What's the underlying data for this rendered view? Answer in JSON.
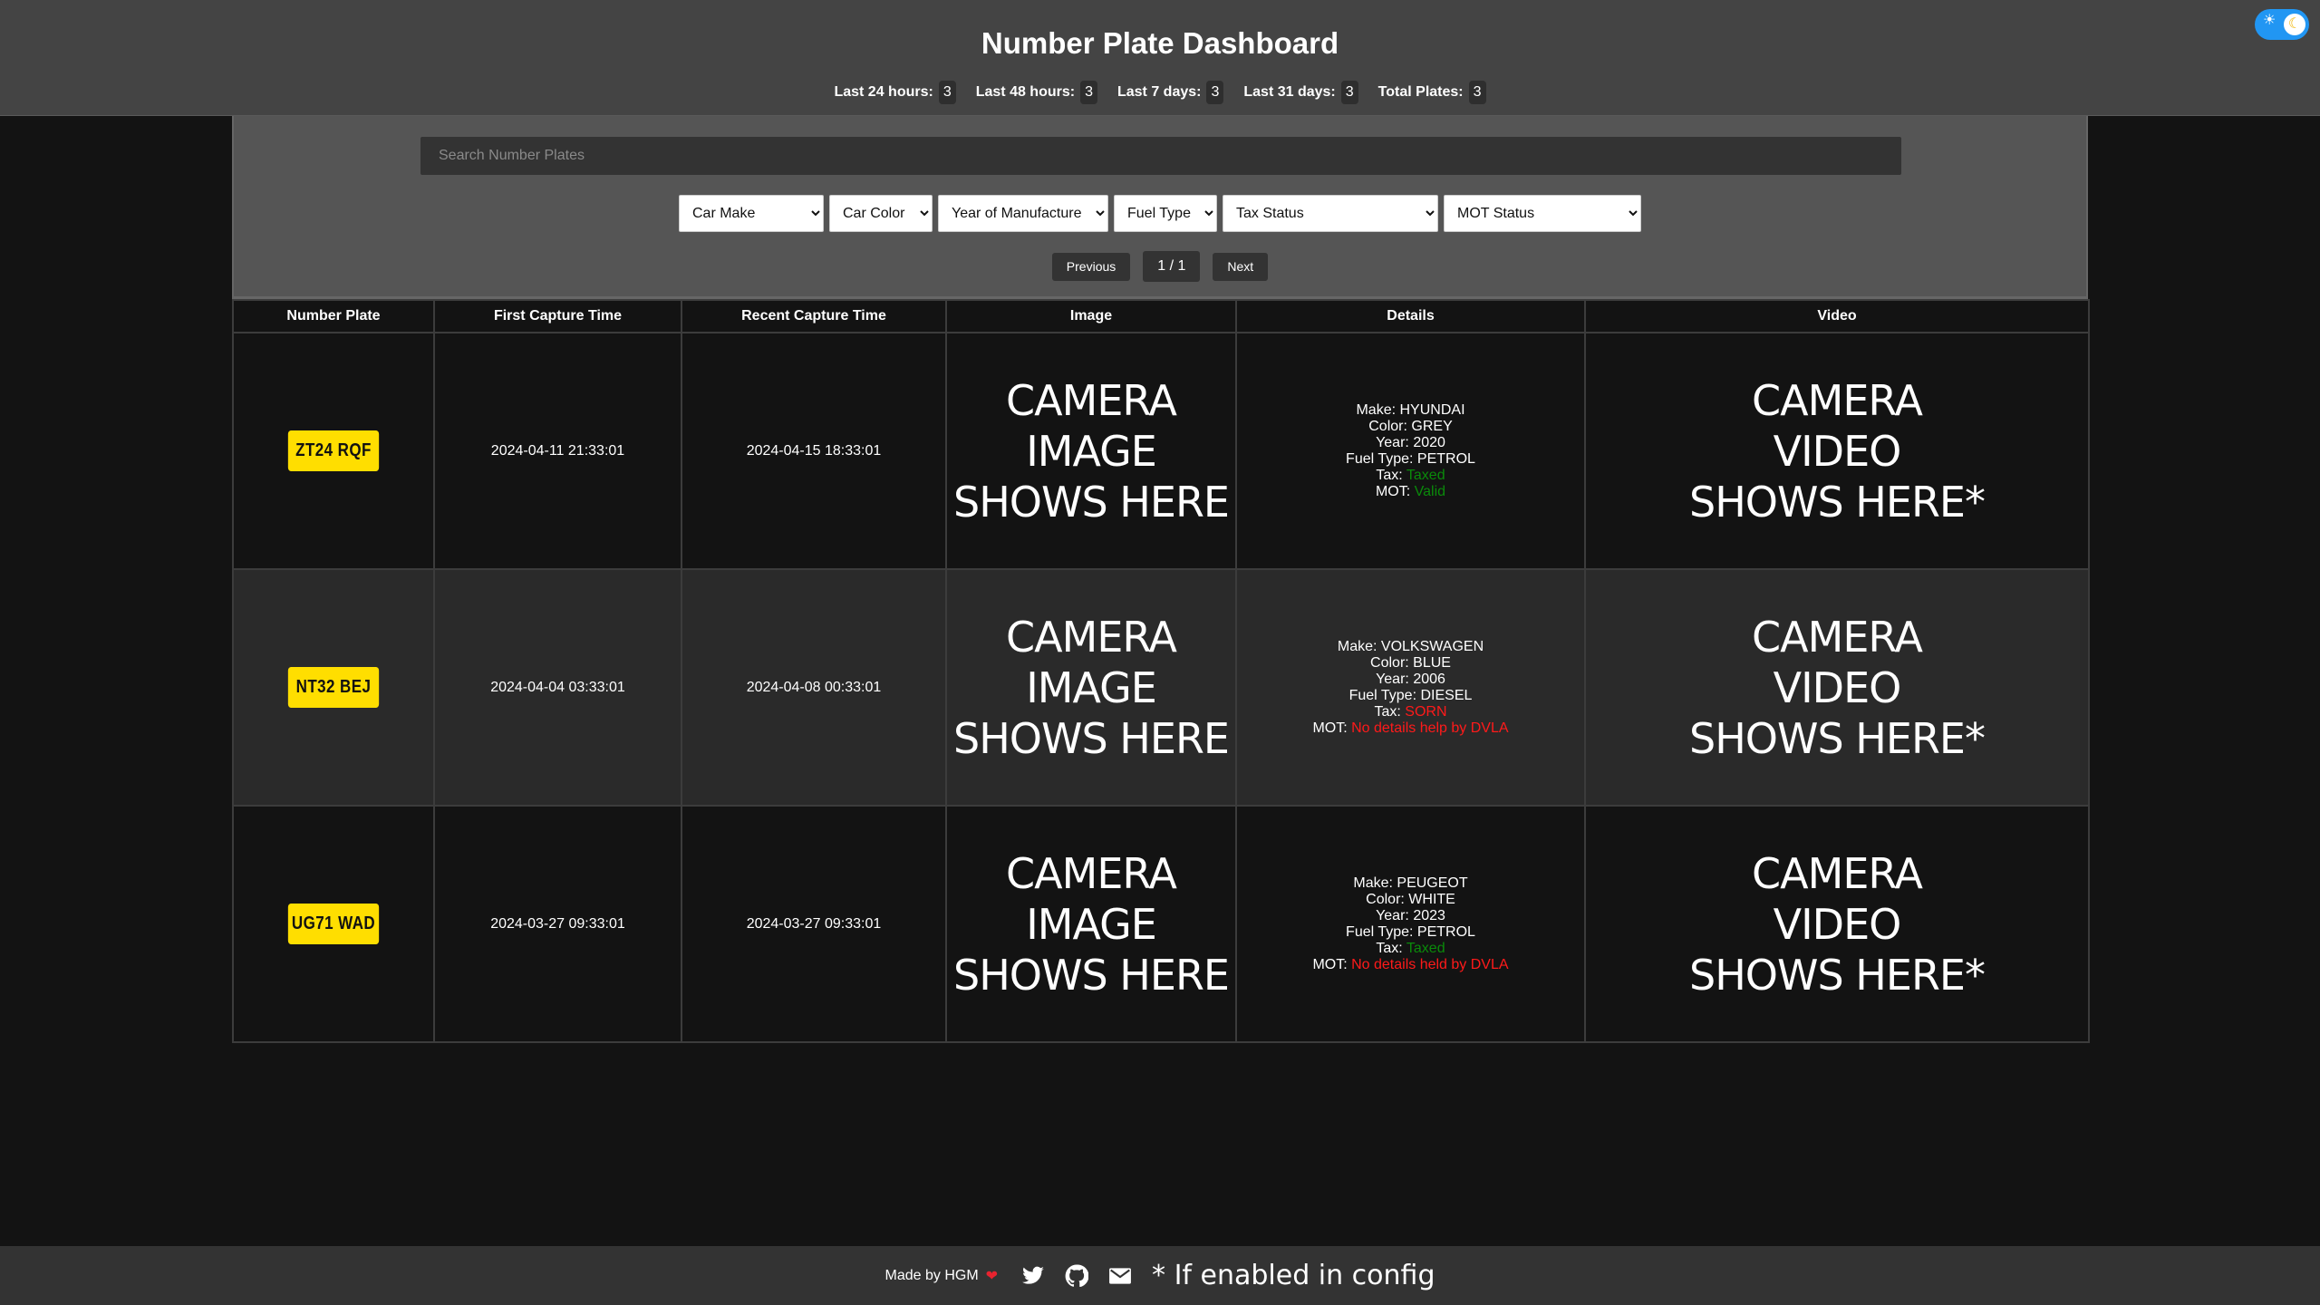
{
  "header": {
    "title": "Number Plate Dashboard",
    "stats": [
      {
        "label": "Last 24 hours:",
        "value": "3"
      },
      {
        "label": "Last 48 hours:",
        "value": "3"
      },
      {
        "label": "Last 7 days:",
        "value": "3"
      },
      {
        "label": "Last 31 days:",
        "value": "3"
      },
      {
        "label": "Total Plates:",
        "value": "3"
      }
    ],
    "theme_toggle": {
      "sun_icon": "☀",
      "moon_icon": "☾",
      "state": "dark"
    }
  },
  "controls": {
    "search": {
      "placeholder": "Search Number Plates",
      "value": ""
    },
    "filters": [
      {
        "name": "car-make",
        "selected": "Car Make"
      },
      {
        "name": "car-color",
        "selected": "Car Color"
      },
      {
        "name": "year-of-manufacture",
        "selected": "Year of Manufacture"
      },
      {
        "name": "fuel-type",
        "selected": "Fuel Type"
      },
      {
        "name": "tax-status",
        "selected": "Tax Status"
      },
      {
        "name": "mot-status",
        "selected": "MOT Status"
      }
    ],
    "pagination": {
      "previous_label": "Previous",
      "page": "1 / 1",
      "next_label": "Next"
    }
  },
  "table": {
    "columns": [
      "Number Plate",
      "First Capture Time",
      "Recent Capture Time",
      "Image",
      "Details",
      "Video"
    ],
    "rows": [
      {
        "plate": "ZT24 RQF",
        "first_capture": "2024-04-11 21:33:01",
        "recent_capture": "2024-04-15 18:33:01",
        "image_placeholder": [
          "CAMERA",
          "IMAGE",
          "SHOWS HERE"
        ],
        "details": {
          "make_label": "Make:",
          "make": "HYUNDAI",
          "color_label": "Color:",
          "color": "GREY",
          "year_label": "Year:",
          "year": "2020",
          "fuel_label": "Fuel Type:",
          "fuel": "PETROL",
          "tax_label": "Tax:",
          "tax": "Taxed",
          "tax_status": "ok",
          "mot_label": "MOT:",
          "mot": "Valid",
          "mot_status": "ok"
        },
        "video_placeholder": [
          "CAMERA",
          "VIDEO",
          "SHOWS HERE*"
        ]
      },
      {
        "plate": "NT32 BEJ",
        "first_capture": "2024-04-04 03:33:01",
        "recent_capture": "2024-04-08 00:33:01",
        "image_placeholder": [
          "CAMERA",
          "IMAGE",
          "SHOWS HERE"
        ],
        "details": {
          "make_label": "Make:",
          "make": "VOLKSWAGEN",
          "color_label": "Color:",
          "color": "BLUE",
          "year_label": "Year:",
          "year": "2006",
          "fuel_label": "Fuel Type:",
          "fuel": "DIESEL",
          "tax_label": "Tax:",
          "tax": "SORN",
          "tax_status": "bad",
          "mot_label": "MOT:",
          "mot": "No details help by DVLA",
          "mot_status": "bad"
        },
        "video_placeholder": [
          "CAMERA",
          "VIDEO",
          "SHOWS HERE*"
        ]
      },
      {
        "plate": "UG71 WAD",
        "first_capture": "2024-03-27 09:33:01",
        "recent_capture": "2024-03-27 09:33:01",
        "image_placeholder": [
          "CAMERA",
          "IMAGE",
          "SHOWS HERE"
        ],
        "details": {
          "make_label": "Make:",
          "make": "PEUGEOT",
          "color_label": "Color:",
          "color": "WHITE",
          "year_label": "Year:",
          "year": "2023",
          "fuel_label": "Fuel Type:",
          "fuel": "PETROL",
          "tax_label": "Tax:",
          "tax": "Taxed",
          "tax_status": "ok",
          "mot_label": "MOT:",
          "mot": "No details held by DVLA",
          "mot_status": "bad"
        },
        "video_placeholder": [
          "CAMERA",
          "VIDEO",
          "SHOWS HERE*"
        ]
      }
    ]
  },
  "footer": {
    "made_by": "Made by HGM",
    "heart_icon": "❤",
    "links": [
      "twitter-icon",
      "github-icon",
      "email-icon"
    ],
    "footnote": "* If enabled in config"
  },
  "colors": {
    "plate_yellow": "#ffde00",
    "ok_green": "#0a8a0a",
    "bad_red": "#ff1a1a",
    "toggle_blue": "#2196f3"
  }
}
